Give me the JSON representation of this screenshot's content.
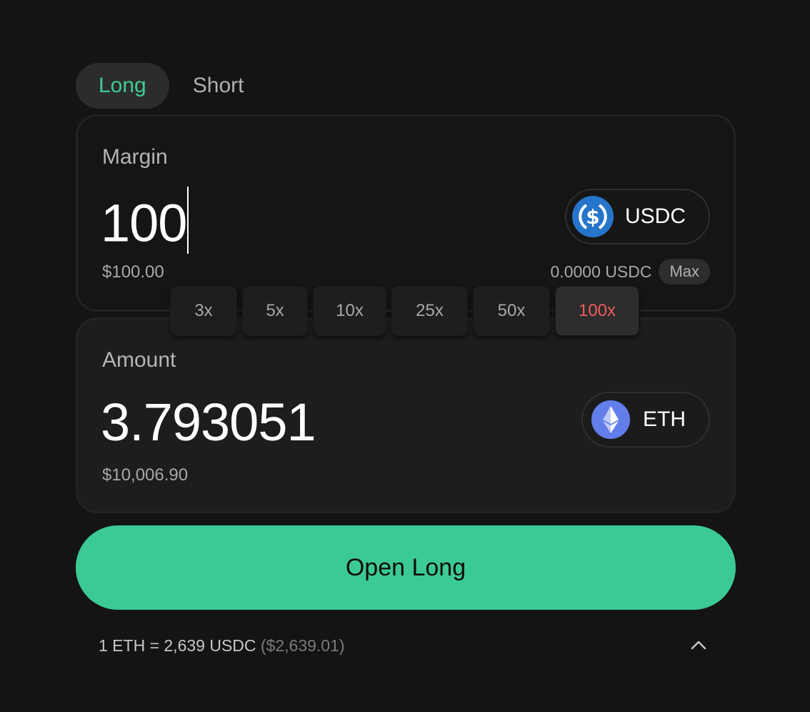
{
  "tabs": [
    {
      "label": "Long",
      "active": true
    },
    {
      "label": "Short",
      "active": false
    }
  ],
  "margin": {
    "label": "Margin",
    "value": "100",
    "usd_value": "$100.00",
    "token": {
      "symbol": "USDC",
      "icon": "usdc-icon",
      "color": "#2775ca"
    },
    "balance": "0.0000 USDC",
    "max_label": "Max"
  },
  "leverage": {
    "options": [
      "3x",
      "5x",
      "10x",
      "25x",
      "50x",
      "100x"
    ],
    "selected": "100x",
    "selected_color": "#f05b5b"
  },
  "amount": {
    "label": "Amount",
    "value": "3.793051",
    "usd_value": "$10,006.90",
    "token": {
      "symbol": "ETH",
      "icon": "eth-icon",
      "color": "#627eea"
    }
  },
  "cta": {
    "label": "Open Long",
    "color": "#3cca94"
  },
  "rate": {
    "text": "1 ETH = 2,639 USDC",
    "usd": "($2,639.01)"
  },
  "accent_color": "#3fcb94"
}
